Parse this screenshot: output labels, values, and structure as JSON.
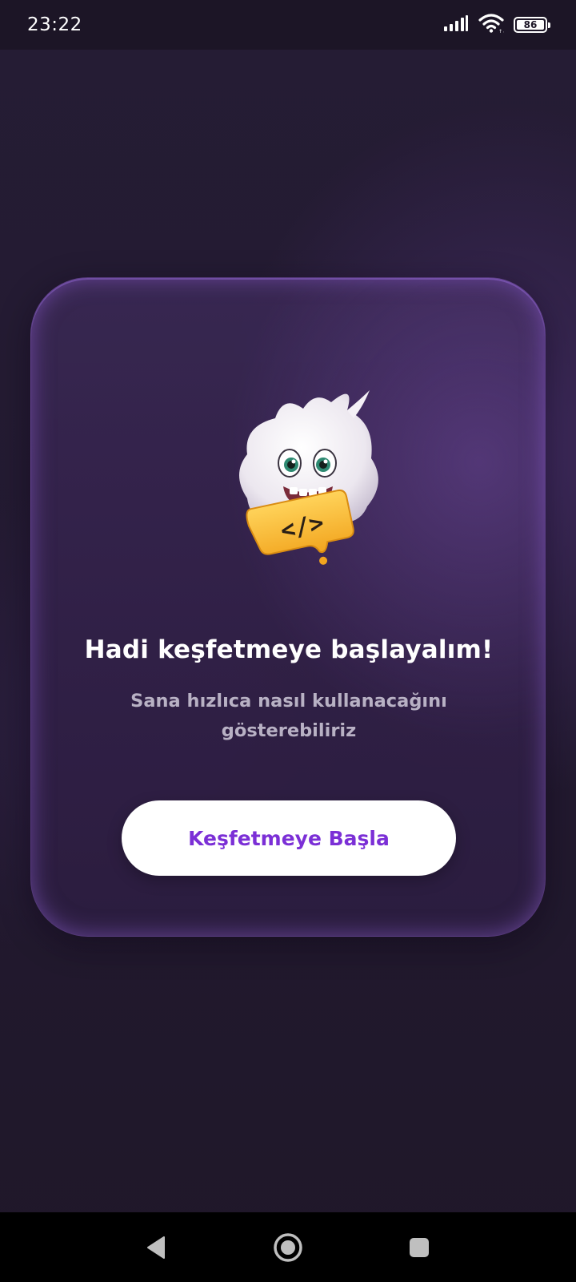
{
  "status_bar": {
    "time": "23:22",
    "battery_level": "86",
    "icons": [
      "signal-icon",
      "wifi-icon",
      "battery-icon"
    ]
  },
  "card": {
    "title": "Hadi keşfetmeye başlayalım!",
    "subtitle": "Sana hızlıca nasıl kullanacağını gösterebiliriz",
    "button_label": "Keşfetmeye Başla",
    "mascot_badge_text": "</>"
  },
  "nav_bar": {
    "icons": [
      "back-icon",
      "home-icon",
      "recents-icon"
    ]
  },
  "colors": {
    "accent": "#7b2fd6",
    "background": "#1e1729",
    "badge": "#f7b52c"
  }
}
